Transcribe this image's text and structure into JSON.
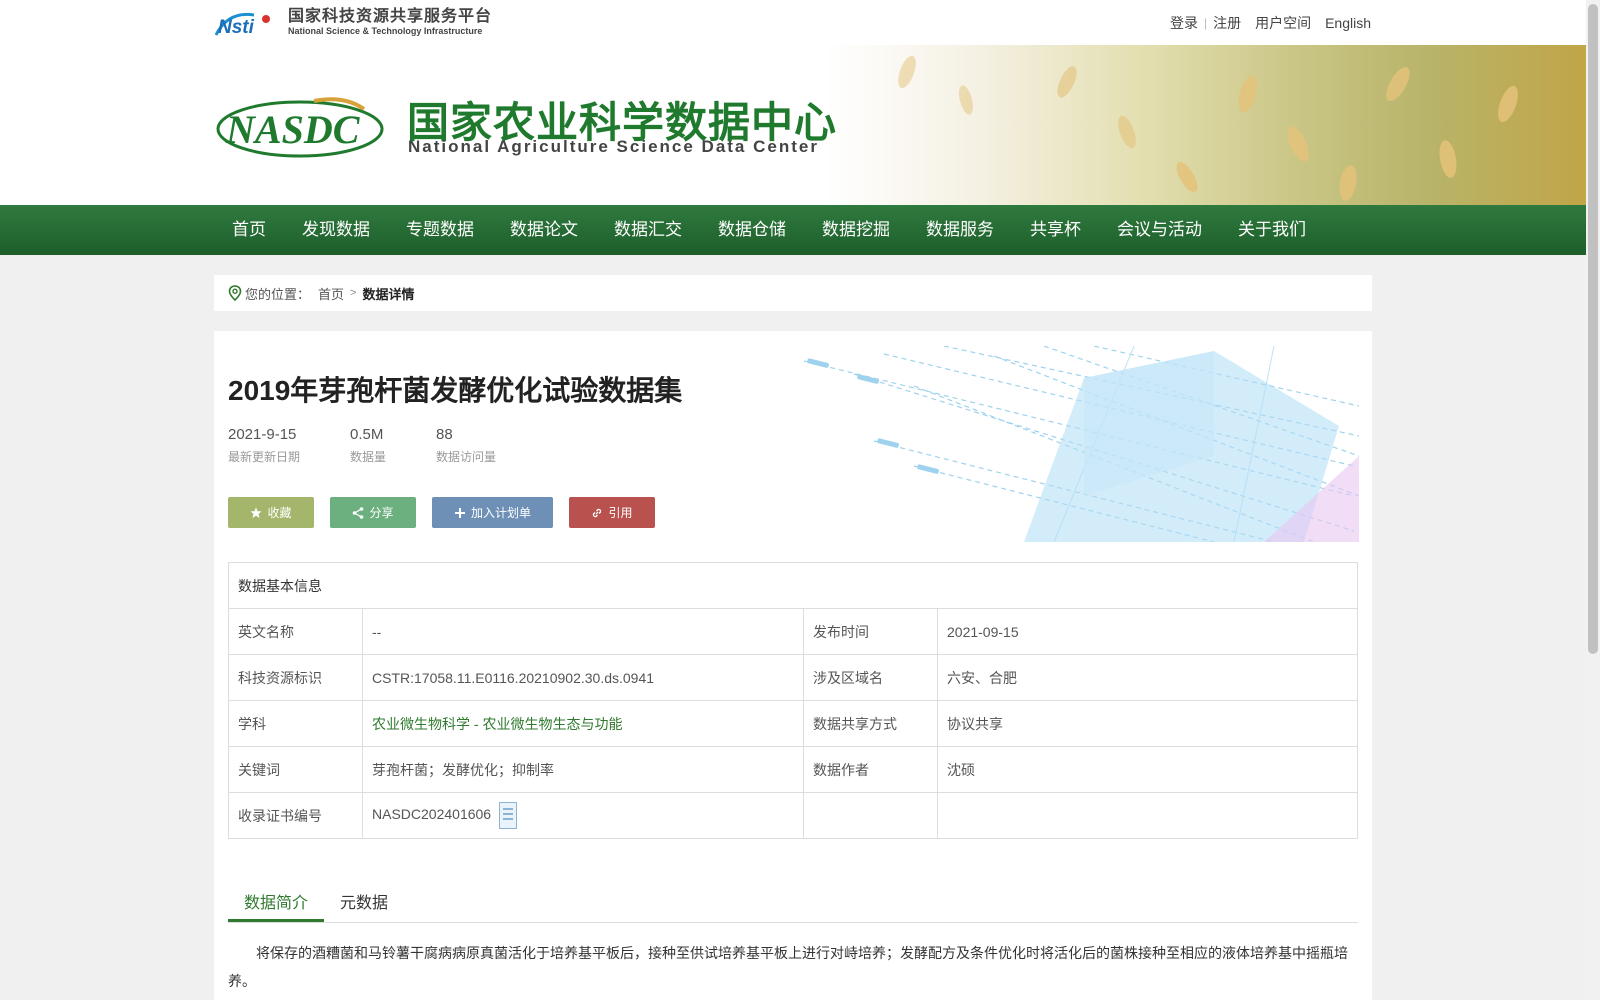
{
  "platform": {
    "name_cn": "国家科技资源共享服务平台",
    "name_en": "National Science & Technology Infrastructure",
    "logo_text": "Nsti"
  },
  "toplinks": {
    "login": "登录",
    "separator": "|",
    "register": "注册",
    "user_space": "用户空间",
    "english": "English"
  },
  "center": {
    "name_cn": "国家农业科学数据中心",
    "name_en": "National Agriculture Science Data Center",
    "logo_text": "NASDC"
  },
  "nav": {
    "items": [
      {
        "label": "首页"
      },
      {
        "label": "发现数据"
      },
      {
        "label": "专题数据"
      },
      {
        "label": "数据论文"
      },
      {
        "label": "数据汇交"
      },
      {
        "label": "数据仓储"
      },
      {
        "label": "数据挖掘"
      },
      {
        "label": "数据服务"
      },
      {
        "label": "共享杯"
      },
      {
        "label": "会议与活动"
      },
      {
        "label": "关于我们"
      }
    ]
  },
  "breadcrumb": {
    "prefix": "您的位置：",
    "home": "首页",
    "arrow": ">",
    "current": "数据详情"
  },
  "dataset": {
    "title": "2019年芽孢杆菌发酵优化试验数据集",
    "stats": [
      {
        "value": "2021-9-15",
        "label": "最新更新日期"
      },
      {
        "value": "0.5M",
        "label": "数据量"
      },
      {
        "value": "88",
        "label": "数据访问量"
      }
    ]
  },
  "actions": {
    "favorite": "收藏",
    "share": "分享",
    "add_plan": "加入计划单",
    "cite": "引用"
  },
  "info": {
    "header": "数据基本信息",
    "rows": [
      {
        "k1": "英文名称",
        "v1": "--",
        "k2": "发布时间",
        "v2": "2021-09-15"
      },
      {
        "k1": "科技资源标识",
        "v1": "CSTR:17058.11.E0116.20210902.30.ds.0941",
        "k2": "涉及区域名",
        "v2": "六安、合肥"
      },
      {
        "k1": "学科",
        "v1": "农业微生物科学 - 农业微生物生态与功能",
        "k2": "数据共享方式",
        "v2": "协议共享"
      },
      {
        "k1": "关键词",
        "v1": "芽孢杆菌；发酵优化；抑制率",
        "k2": "数据作者",
        "v2": "沈硕"
      },
      {
        "k1": "收录证书编号",
        "v1": "NASDC202401606",
        "k2": "",
        "v2": ""
      }
    ]
  },
  "tabs": {
    "intro": "数据简介",
    "metadata": "元数据"
  },
  "description": "将保存的酒糟菌和马铃薯干腐病病原真菌活化于培养基平板后，接种至供试培养基平板上进行对峙培养；发酵配方及条件优化时将活化后的菌株接种至相应的液体培养基中摇瓶培养。",
  "colors": {
    "brand_green": "#1f7a2e",
    "nav_green": "#1d5e2b",
    "fav": "#a4b66c",
    "share": "#6db080",
    "plan": "#6e90b6",
    "cite": "#b9514f"
  }
}
